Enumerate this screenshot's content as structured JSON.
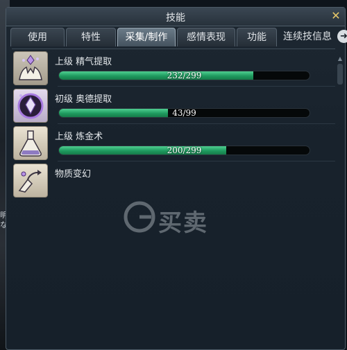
{
  "window": {
    "title": "技能"
  },
  "tabs": [
    {
      "label": "使用",
      "active": false
    },
    {
      "label": "特性",
      "active": false
    },
    {
      "label": "采集/制作",
      "active": true
    },
    {
      "label": "感情表现",
      "active": false
    },
    {
      "label": "功能",
      "active": false
    },
    {
      "label": "连续技信息",
      "active": false
    }
  ],
  "skills": [
    {
      "name": "上级 精气提取",
      "progress_text": "232/299",
      "current": 232,
      "max": 299,
      "icon": "hands-crystal-icon"
    },
    {
      "name": "初级 奥德提取",
      "progress_text": "43/99",
      "current": 43,
      "max": 99,
      "icon": "purple-crystal-icon"
    },
    {
      "name": "上级 炼金术",
      "progress_text": "200/299",
      "current": 200,
      "max": 299,
      "icon": "potion-flask-icon"
    },
    {
      "name": "物质变幻",
      "icon": "transmutation-hand-icon"
    }
  ],
  "watermark": {
    "text": "买卖"
  },
  "background": {
    "left_text": "明 な"
  },
  "colors": {
    "bar_fill": "#1f9a5f",
    "active_tab": "#6b7b88",
    "close_icon": "#e8c869"
  }
}
